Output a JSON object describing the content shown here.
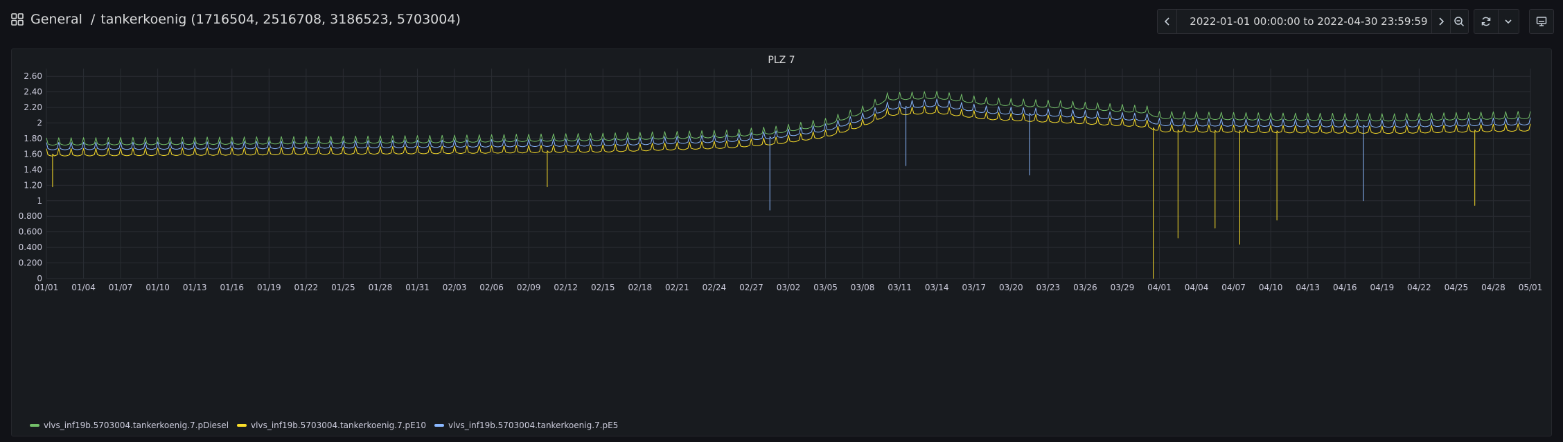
{
  "breadcrumb": {
    "folder": "General",
    "separator": "/",
    "title": "tankerkoenig (1716504, 2516708, 3186523, 5703004)"
  },
  "time_range": {
    "text": "2022-01-01 00:00:00 to 2022-04-30 23:59:59"
  },
  "icons": {
    "dashboards": "grid-icon",
    "back": "chevron-left-icon",
    "clock": "clock-icon",
    "picker_caret": "chevron-down-icon",
    "forward": "chevron-right-icon",
    "zoom_out": "zoom-out-icon",
    "refresh": "refresh-icon",
    "refresh_caret": "chevron-down-icon",
    "tv_mode": "monitor-icon"
  },
  "panel": {
    "title": "PLZ 7"
  },
  "colors": {
    "background": "#111217",
    "panel": "#181b1f",
    "grid": "#2a2d33",
    "diesel": "#73bf69",
    "e10": "#fade2a",
    "e5": "#8ab8ff"
  },
  "chart_data": {
    "type": "line",
    "ylim": [
      0,
      2.7
    ],
    "y_ticks": [
      "0",
      "0.200",
      "0.400",
      "0.600",
      "0.800",
      "1",
      "1.20",
      "1.40",
      "1.60",
      "1.80",
      "2",
      "2.20",
      "2.40",
      "2.60"
    ],
    "y_tick_values": [
      0,
      0.2,
      0.4,
      0.6,
      0.8,
      1,
      1.2,
      1.4,
      1.6,
      1.8,
      2,
      2.2,
      2.4,
      2.6
    ],
    "x_range": [
      "2022-01-01",
      "2022-05-01"
    ],
    "x_ticks": [
      "01/01",
      "01/04",
      "01/07",
      "01/10",
      "01/13",
      "01/16",
      "01/19",
      "01/22",
      "01/25",
      "01/28",
      "01/31",
      "02/03",
      "02/06",
      "02/09",
      "02/12",
      "02/15",
      "02/18",
      "02/21",
      "02/24",
      "02/27",
      "03/02",
      "03/05",
      "03/08",
      "03/11",
      "03/14",
      "03/17",
      "03/20",
      "03/23",
      "03/26",
      "03/29",
      "04/01",
      "04/04",
      "04/07",
      "04/10",
      "04/13",
      "04/16",
      "04/19",
      "04/22",
      "04/25",
      "04/28",
      "05/01"
    ],
    "x_tick_days": [
      0,
      3,
      6,
      9,
      12,
      15,
      18,
      21,
      24,
      27,
      30,
      33,
      36,
      39,
      42,
      45,
      48,
      51,
      54,
      57,
      60,
      63,
      66,
      69,
      72,
      75,
      78,
      81,
      84,
      87,
      90,
      93,
      96,
      99,
      102,
      105,
      108,
      111,
      114,
      117,
      120
    ],
    "series": [
      {
        "name": "vlvs_inf19b.5703004.tankerkoenig.7.pDiesel",
        "color": "#73bf69",
        "x": [
          "2022-01-01",
          "2022-01-15",
          "2022-02-01",
          "2022-02-15",
          "2022-02-25",
          "2022-03-01",
          "2022-03-05",
          "2022-03-08",
          "2022-03-10",
          "2022-03-14",
          "2022-03-18",
          "2022-03-25",
          "2022-03-31",
          "2022-04-01",
          "2022-04-10",
          "2022-04-20",
          "2022-04-30"
        ],
        "y": [
          1.74,
          1.75,
          1.77,
          1.8,
          1.84,
          1.89,
          1.99,
          2.15,
          2.32,
          2.34,
          2.26,
          2.21,
          2.15,
          2.08,
          2.06,
          2.05,
          2.08
        ]
      },
      {
        "name": "vlvs_inf19b.5703004.tankerkoenig.7.pE10",
        "color": "#fade2a",
        "x": [
          "2022-01-01",
          "2022-01-15",
          "2022-02-01",
          "2022-02-15",
          "2022-02-25",
          "2022-03-01",
          "2022-03-05",
          "2022-03-08",
          "2022-03-10",
          "2022-03-14",
          "2022-03-18",
          "2022-03-25",
          "2022-03-31",
          "2022-04-01",
          "2022-04-10",
          "2022-04-20",
          "2022-04-30"
        ],
        "y": [
          1.6,
          1.61,
          1.63,
          1.65,
          1.7,
          1.75,
          1.84,
          1.98,
          2.12,
          2.15,
          2.07,
          2.02,
          1.97,
          1.91,
          1.9,
          1.89,
          1.92
        ]
      },
      {
        "name": "vlvs_inf19b.5703004.tankerkoenig.7.pE5",
        "color": "#8ab8ff",
        "x": [
          "2022-01-01",
          "2022-01-15",
          "2022-02-01",
          "2022-02-15",
          "2022-02-25",
          "2022-03-01",
          "2022-03-05",
          "2022-03-08",
          "2022-03-10",
          "2022-03-14",
          "2022-03-18",
          "2022-03-25",
          "2022-03-31",
          "2022-04-01",
          "2022-04-10",
          "2022-04-20",
          "2022-04-30"
        ],
        "y": [
          1.68,
          1.69,
          1.71,
          1.73,
          1.78,
          1.83,
          1.92,
          2.06,
          2.2,
          2.24,
          2.15,
          2.1,
          2.05,
          1.99,
          1.98,
          1.97,
          2.0
        ]
      }
    ],
    "dips": [
      {
        "series": "vlvs_inf19b.5703004.tankerkoenig.7.pE10",
        "x": "2022-01-01",
        "y": 1.18
      },
      {
        "series": "vlvs_inf19b.5703004.tankerkoenig.7.pE10",
        "x": "2022-02-10",
        "y": 1.18
      },
      {
        "series": "vlvs_inf19b.5703004.tankerkoenig.7.pE5",
        "x": "2022-02-28",
        "y": 0.88
      },
      {
        "series": "vlvs_inf19b.5703004.tankerkoenig.7.pE5",
        "x": "2022-03-11",
        "y": 1.45
      },
      {
        "series": "vlvs_inf19b.5703004.tankerkoenig.7.pE5",
        "x": "2022-03-21",
        "y": 1.33
      },
      {
        "series": "vlvs_inf19b.5703004.tankerkoenig.7.pE10",
        "x": "2022-03-31",
        "y": 0.0
      },
      {
        "series": "vlvs_inf19b.5703004.tankerkoenig.7.pE10",
        "x": "2022-04-02",
        "y": 0.52
      },
      {
        "series": "vlvs_inf19b.5703004.tankerkoenig.7.pE10",
        "x": "2022-04-05",
        "y": 0.65
      },
      {
        "series": "vlvs_inf19b.5703004.tankerkoenig.7.pE10",
        "x": "2022-04-07",
        "y": 0.44
      },
      {
        "series": "vlvs_inf19b.5703004.tankerkoenig.7.pE10",
        "x": "2022-04-10",
        "y": 0.75
      },
      {
        "series": "vlvs_inf19b.5703004.tankerkoenig.7.pE5",
        "x": "2022-04-17",
        "y": 1.0
      },
      {
        "series": "vlvs_inf19b.5703004.tankerkoenig.7.pE10",
        "x": "2022-04-26",
        "y": 0.94
      }
    ]
  }
}
